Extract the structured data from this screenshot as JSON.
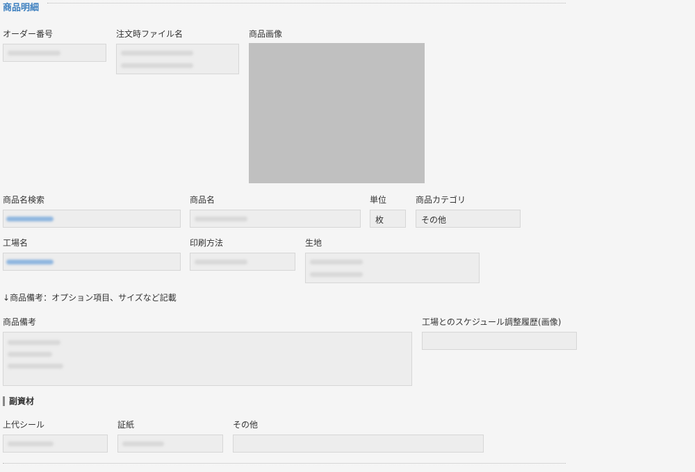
{
  "section": {
    "title": "商品明細"
  },
  "labels": {
    "order_no": "オーダー番号",
    "order_file": "注文時ファイル名",
    "product_image": "商品画像",
    "product_search": "商品名検索",
    "product_name": "商品名",
    "unit": "単位",
    "category": "商品カテゴリ",
    "factory_name": "工場名",
    "print_method": "印刷方法",
    "fabric": "生地",
    "product_note": "商品備考",
    "schedule_history": "工場とのスケジュール調整履歴(画像)",
    "tag_seal": "上代シール",
    "certificate": "証紙",
    "other": "その他"
  },
  "values": {
    "unit": "枚",
    "category": "その他"
  },
  "note": {
    "arrow": "↓",
    "text": "商品備考：オプション項目、サイズなど記載"
  },
  "sub_materials": {
    "title": "副資材"
  }
}
